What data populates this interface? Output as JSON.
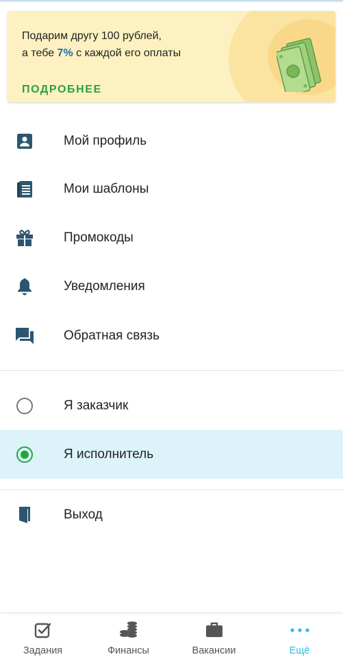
{
  "promo": {
    "line1": "Подарим другу 100 рублей,",
    "line2_before": "а тебе ",
    "line2_percent": "7%",
    "line2_after": " с каждой его оплаты",
    "more_label": "ПОДРОБНЕЕ",
    "image_icon": "money-bills-icon"
  },
  "menu": [
    {
      "label": "Мой профиль",
      "icon": "profile-icon"
    },
    {
      "label": "Мои шаблоны",
      "icon": "templates-icon"
    },
    {
      "label": "Промокоды",
      "icon": "gift-icon"
    },
    {
      "label": "Уведомления",
      "icon": "bell-icon"
    },
    {
      "label": "Обратная связь",
      "icon": "feedback-icon"
    }
  ],
  "roles": [
    {
      "label": "Я заказчик",
      "selected": false
    },
    {
      "label": "Я исполнитель",
      "selected": true
    }
  ],
  "logout": {
    "label": "Выход",
    "icon": "exit-door-icon"
  },
  "bottom_nav": [
    {
      "label": "Задания",
      "icon": "checkbox-icon",
      "active": false
    },
    {
      "label": "Финансы",
      "icon": "coins-icon",
      "active": false
    },
    {
      "label": "Вакансии",
      "icon": "briefcase-icon",
      "active": false
    },
    {
      "label": "Ещё",
      "icon": "more-dots-icon",
      "active": true
    }
  ],
  "colors": {
    "icon": "#2c5670",
    "accent_green": "#26a33c",
    "accent_blue": "#2fb9e4",
    "promo_bg": "#fdf1c2",
    "selected_bg": "#dcf3fa"
  }
}
